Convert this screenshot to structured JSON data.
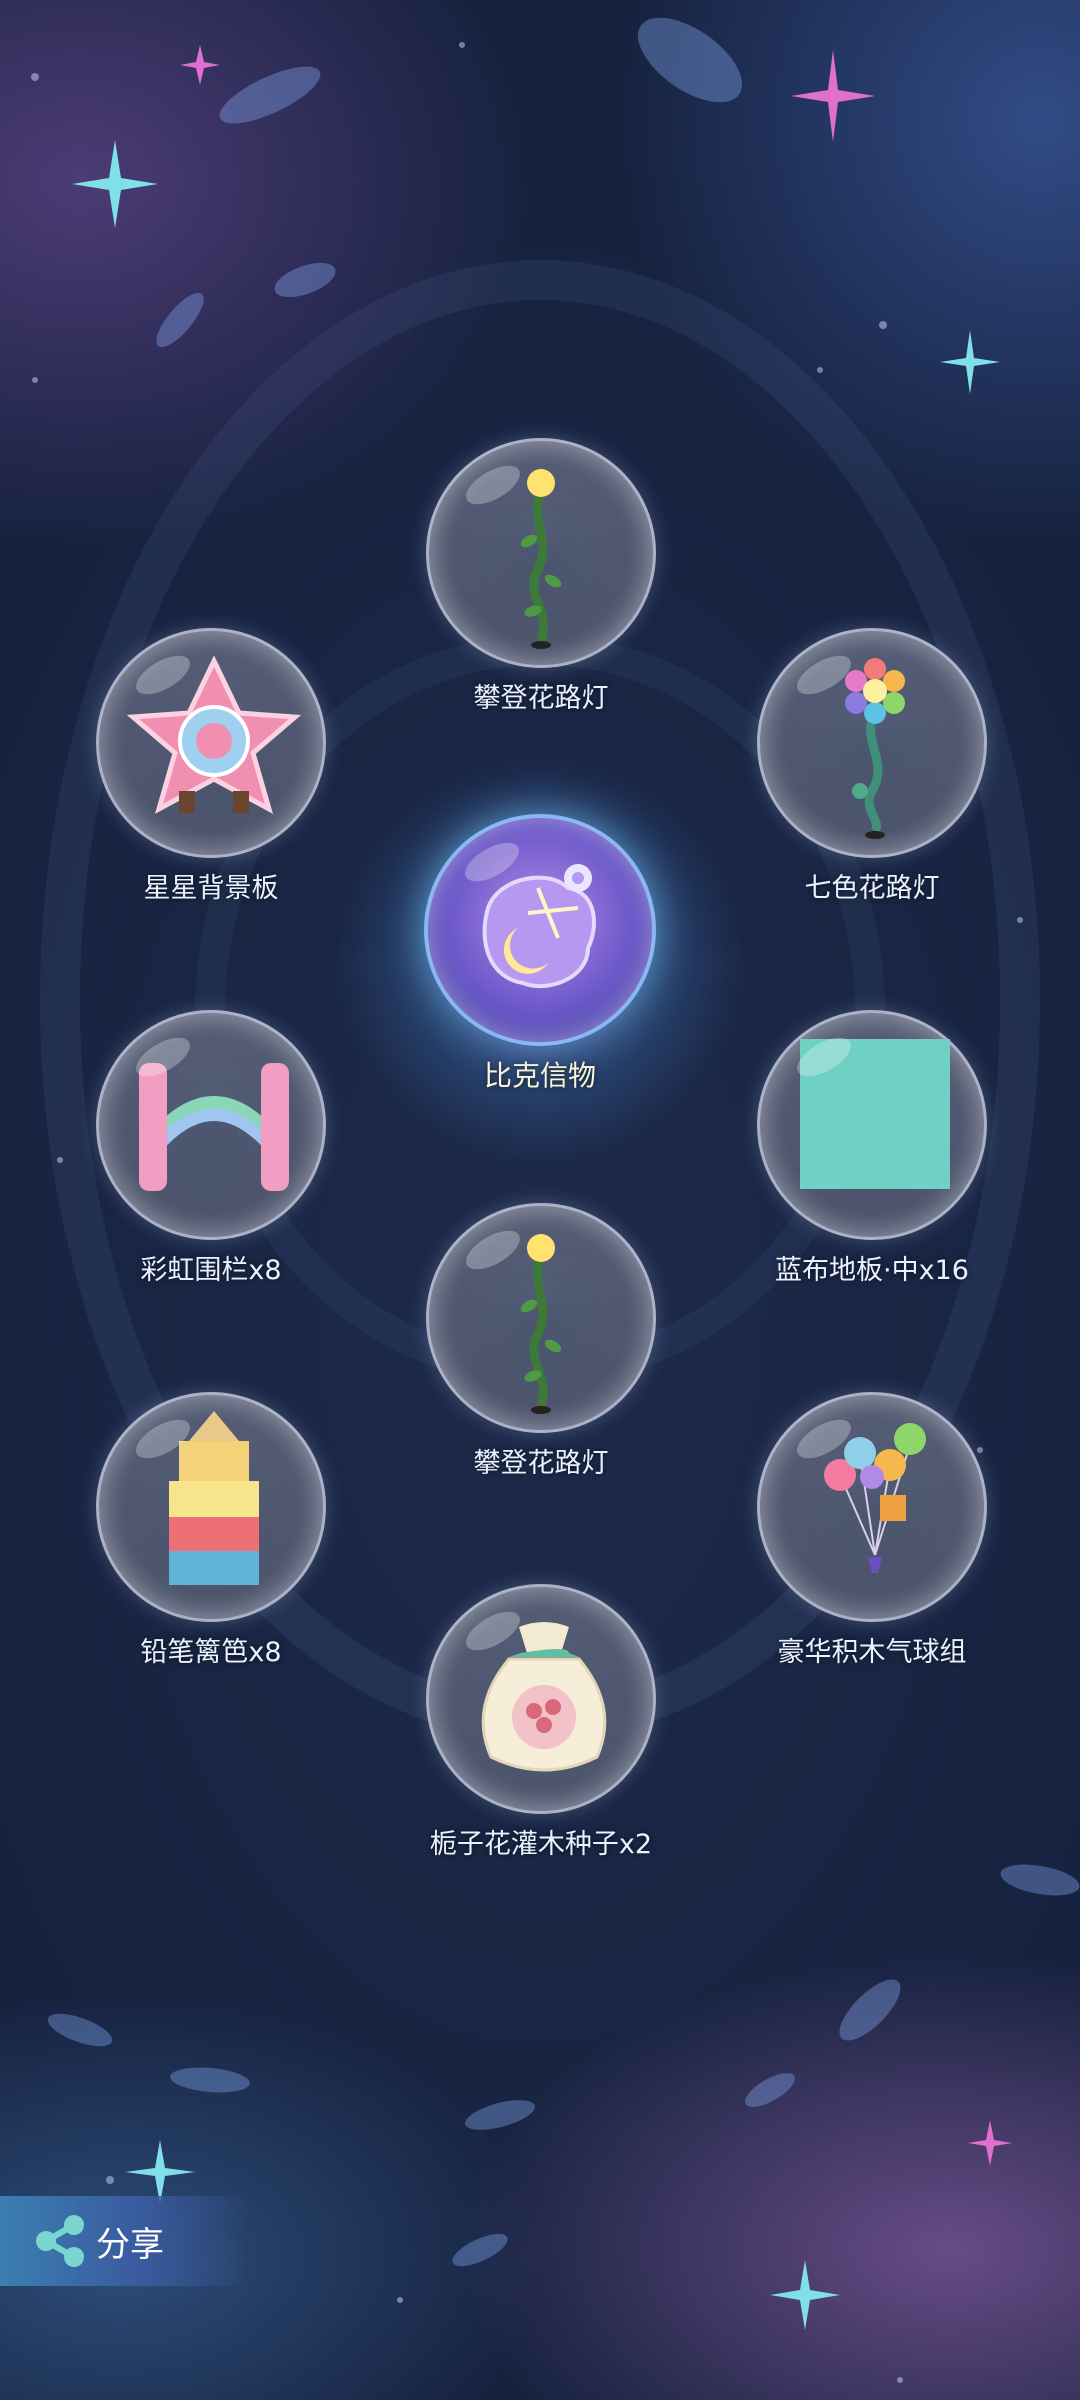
{
  "center_item": {
    "label": "比克信物",
    "icon": "constellation-token-icon"
  },
  "items": [
    {
      "label": "攀登花路灯",
      "icon": "climbing-flower-lamp-icon"
    },
    {
      "label": "星星背景板",
      "icon": "star-backdrop-icon"
    },
    {
      "label": "七色花路灯",
      "icon": "rainbow-flower-lamp-icon"
    },
    {
      "label": "彩虹围栏x8",
      "icon": "rainbow-fence-icon"
    },
    {
      "label": "蓝布地板·中x16",
      "icon": "blue-cloth-floor-icon"
    },
    {
      "label": "攀登花路灯",
      "icon": "climbing-flower-lamp-icon"
    },
    {
      "label": "铅笔篱笆x8",
      "icon": "pencil-fence-icon"
    },
    {
      "label": "豪华积木气球组",
      "icon": "balloon-bunch-icon"
    },
    {
      "label": "栀子花灌木种子x2",
      "icon": "seed-bag-icon"
    }
  ],
  "share": {
    "label": "分享",
    "icon": "share-icon"
  },
  "colors": {
    "background": "#1a2646",
    "label_text": "#e9f2ff",
    "center_label": "#fff6d6",
    "share_button": "#3b7fb0"
  }
}
